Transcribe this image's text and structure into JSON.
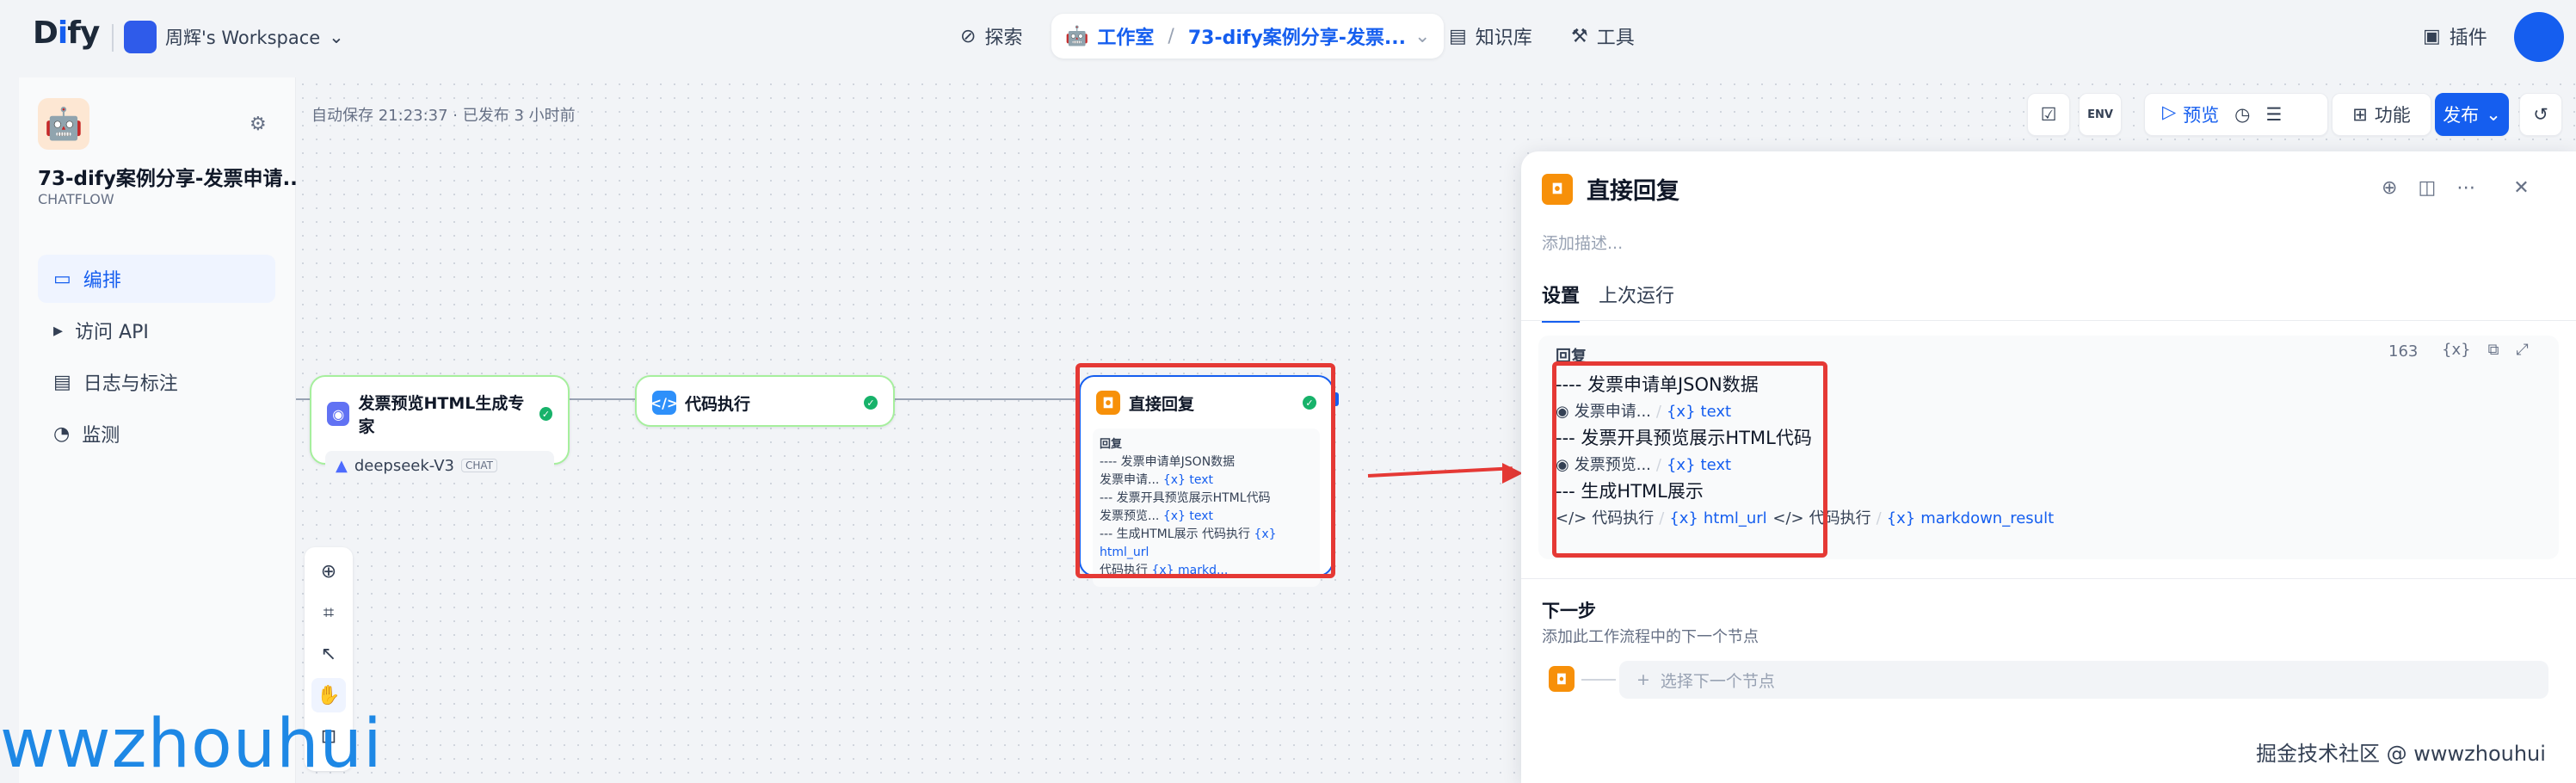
{
  "topbar": {
    "logo_prefix": "D",
    "logo_mid": "i",
    "logo_suffix": "fy",
    "workspace": "周辉's Workspace",
    "nav": {
      "explore": "探索",
      "studio": "工作室",
      "studio_app": "73-dify案例分享-发票...",
      "knowledge": "知识库",
      "tools": "工具",
      "plugins": "插件"
    }
  },
  "app": {
    "title": "73-dify案例分享-发票申请...",
    "type": "CHATFLOW",
    "menu": [
      {
        "label": "编排"
      },
      {
        "label": "访问 API"
      },
      {
        "label": "日志与标注"
      },
      {
        "label": "监测"
      }
    ]
  },
  "canvas": {
    "autosave": "自动保存 21:23:37 · 已发布 3 小时前",
    "toolbar": {
      "env": "ENV",
      "preview": "预览",
      "features": "功能",
      "publish": "发布"
    },
    "nodes": {
      "llm": {
        "title": "发票预览HTML生成专家",
        "model": "deepseek-V3",
        "mode": "CHAT"
      },
      "code": {
        "title": "代码执行"
      },
      "answer": {
        "title": "直接回复",
        "label": "回复",
        "line1": "---- 发票申请单JSON数据",
        "var1_node": "发票申请...",
        "var1_name": "text",
        "line2": "--- 发票开具预览展示HTML代码",
        "var2_node": "发票预览...",
        "var2_name": "text",
        "line3": "--- 生成HTML展示",
        "var3_node": "代码执行",
        "var3_name": "html_url",
        "var4_node": "代码执行",
        "var4_name": "markd..."
      }
    }
  },
  "panel": {
    "title": "直接回复",
    "desc_placeholder": "添加描述...",
    "tabs": [
      "设置",
      "上次运行"
    ],
    "answer_label": "回复",
    "answer_count": "163",
    "answer_lines": [
      "---- 发票申请单JSON数据",
      "--- 发票开具预览展示HTML代码",
      "--- 生成HTML展示"
    ],
    "vars": [
      {
        "node": "发票申请...",
        "name": "text"
      },
      {
        "node": "发票预览...",
        "name": "text"
      },
      {
        "node": "代码执行",
        "name": "html_url"
      },
      {
        "node": "代码执行",
        "name": "markdown_result"
      }
    ],
    "next_title": "下一步",
    "next_sub": "添加此工作流程中的下一个节点",
    "next_select": "选择下一个节点"
  },
  "watermarks": {
    "left": "wwzhouhui",
    "right": "掘金技术社区 @ wwwzhouhui"
  },
  "colors": {
    "primary": "#155eef",
    "success": "#17b26a",
    "answer_orange": "#f79009",
    "code_blue": "#2e90fa",
    "llm_purple": "#6172f3",
    "highlight_red": "#e53935"
  }
}
